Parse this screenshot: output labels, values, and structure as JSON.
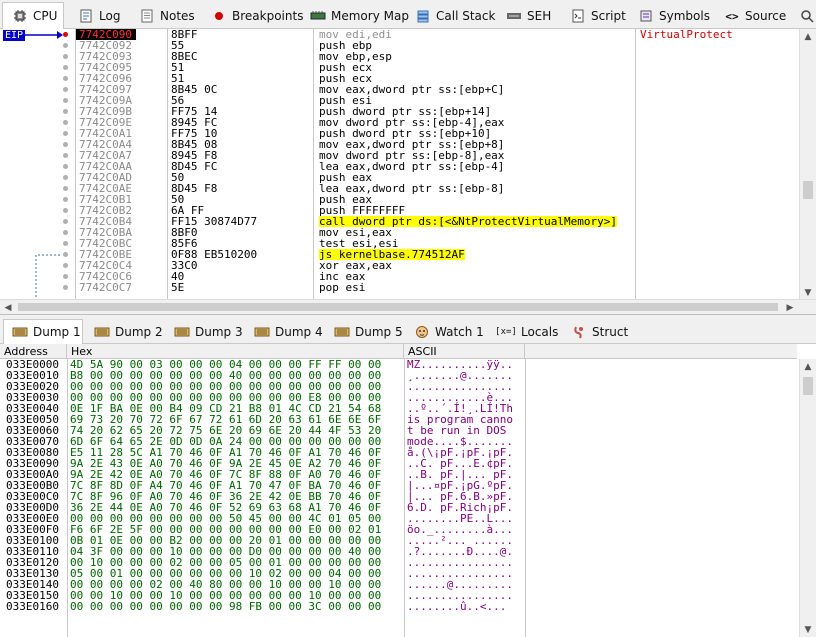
{
  "top_tabs": [
    {
      "label": "CPU",
      "icon": "cpu-icon"
    },
    {
      "label": "Log",
      "icon": "log-icon"
    },
    {
      "label": "Notes",
      "icon": "notes-icon"
    },
    {
      "label": "Breakpoints",
      "icon": "breakpoint-dot-icon"
    },
    {
      "label": "Memory Map",
      "icon": "memory-map-icon"
    },
    {
      "label": "Call Stack",
      "icon": "call-stack-icon"
    },
    {
      "label": "SEH",
      "icon": "seh-icon"
    },
    {
      "label": "Script",
      "icon": "script-icon"
    },
    {
      "label": "Symbols",
      "icon": "symbols-icon"
    },
    {
      "label": "Source",
      "icon": "source-icon"
    }
  ],
  "cpu": {
    "eip_label": "EIP",
    "rows": [
      {
        "addr": "7742C090",
        "bytes": "8BFF",
        "instr": "mov edi,edi",
        "comment": "VirtualProtect",
        "current": true
      },
      {
        "addr": "7742C092",
        "bytes": "55",
        "instr": "push ebp",
        "comment": ""
      },
      {
        "addr": "7742C093",
        "bytes": "8BEC",
        "instr": "mov ebp,esp",
        "comment": ""
      },
      {
        "addr": "7742C095",
        "bytes": "51",
        "instr": "push ecx",
        "comment": ""
      },
      {
        "addr": "7742C096",
        "bytes": "51",
        "instr": "push ecx",
        "comment": ""
      },
      {
        "addr": "7742C097",
        "bytes": "8B45 0C",
        "instr": "mov eax,dword ptr ss:[ebp+C]",
        "comment": ""
      },
      {
        "addr": "7742C09A",
        "bytes": "56",
        "instr": "push esi",
        "comment": ""
      },
      {
        "addr": "7742C09B",
        "bytes": "FF75 14",
        "instr": "push dword ptr ss:[ebp+14]",
        "comment": ""
      },
      {
        "addr": "7742C09E",
        "bytes": "8945 FC",
        "instr": "mov dword ptr ss:[ebp-4],eax",
        "comment": ""
      },
      {
        "addr": "7742C0A1",
        "bytes": "FF75 10",
        "instr": "push dword ptr ss:[ebp+10]",
        "comment": ""
      },
      {
        "addr": "7742C0A4",
        "bytes": "8B45 08",
        "instr": "mov eax,dword ptr ss:[ebp+8]",
        "comment": ""
      },
      {
        "addr": "7742C0A7",
        "bytes": "8945 F8",
        "instr": "mov dword ptr ss:[ebp-8],eax",
        "comment": ""
      },
      {
        "addr": "7742C0AA",
        "bytes": "8D45 FC",
        "instr": "lea eax,dword ptr ss:[ebp-4]",
        "comment": ""
      },
      {
        "addr": "7742C0AD",
        "bytes": "50",
        "instr": "push eax",
        "comment": ""
      },
      {
        "addr": "7742C0AE",
        "bytes": "8D45 F8",
        "instr": "lea eax,dword ptr ss:[ebp-8]",
        "comment": ""
      },
      {
        "addr": "7742C0B1",
        "bytes": "50",
        "instr": "push eax",
        "comment": ""
      },
      {
        "addr": "7742C0B2",
        "bytes": "6A FF",
        "instr": "push FFFFFFFF",
        "comment": ""
      },
      {
        "addr": "7742C0B4",
        "bytes": "FF15 30874D77",
        "instr": "call dword ptr ds:[<&NtProtectVirtualMemory>]",
        "comment": ""
      },
      {
        "addr": "7742C0BA",
        "bytes": "8BF0",
        "instr": "mov esi,eax",
        "comment": ""
      },
      {
        "addr": "7742C0BC",
        "bytes": "85F6",
        "instr": "test esi,esi",
        "comment": ""
      },
      {
        "addr": "7742C0BE",
        "bytes": "0F88 EB510200",
        "instr": "js kernelbase.774512AF",
        "comment": ""
      },
      {
        "addr": "7742C0C4",
        "bytes": "33C0",
        "instr": "xor eax,eax",
        "comment": ""
      },
      {
        "addr": "7742C0C6",
        "bytes": "40",
        "instr": "inc eax",
        "comment": ""
      },
      {
        "addr": "7742C0C7",
        "bytes": "5E",
        "instr": "pop esi",
        "comment": ""
      }
    ]
  },
  "dump_tabs": [
    {
      "label": "Dump 1",
      "icon": "dump-icon"
    },
    {
      "label": "Dump 2",
      "icon": "dump-icon"
    },
    {
      "label": "Dump 3",
      "icon": "dump-icon"
    },
    {
      "label": "Dump 4",
      "icon": "dump-icon"
    },
    {
      "label": "Dump 5",
      "icon": "dump-icon"
    },
    {
      "label": "Watch 1",
      "icon": "watch-icon"
    },
    {
      "label": "Locals",
      "icon": "locals-icon"
    },
    {
      "label": "Struct",
      "icon": "struct-icon"
    }
  ],
  "dump": {
    "headers": {
      "address": "Address",
      "hex": "Hex",
      "ascii": "ASCII"
    },
    "rows": [
      {
        "addr": "033E0000",
        "hex": "4D 5A 90 00 03 00 00 00 04 00 00 00 FF FF 00 00",
        "ascii": "MZ..........ÿÿ.."
      },
      {
        "addr": "033E0010",
        "hex": "B8 00 00 00 00 00 00 00 40 00 00 00 00 00 00 00",
        "ascii": "¸.......@......."
      },
      {
        "addr": "033E0020",
        "hex": "00 00 00 00 00 00 00 00 00 00 00 00 00 00 00 00",
        "ascii": "................"
      },
      {
        "addr": "033E0030",
        "hex": "00 00 00 00 00 00 00 00 00 00 00 00 E8 00 00 00",
        "ascii": "............è..."
      },
      {
        "addr": "033E0040",
        "hex": "0E 1F BA 0E 00 B4 09 CD 21 B8 01 4C CD 21 54 68",
        "ascii": "..º..´.Í!¸.LÍ!Th"
      },
      {
        "addr": "033E0050",
        "hex": "69 73 20 70 72 6F 67 72 61 6D 20 63 61 6E 6E 6F",
        "ascii": "is program canno"
      },
      {
        "addr": "033E0060",
        "hex": "74 20 62 65 20 72 75 6E 20 69 6E 20 44 4F 53 20",
        "ascii": "t be run in DOS "
      },
      {
        "addr": "033E0070",
        "hex": "6D 6F 64 65 2E 0D 0D 0A 24 00 00 00 00 00 00 00",
        "ascii": "mode....$......."
      },
      {
        "addr": "033E0080",
        "hex": "E5 11 28 5C A1 70 46 0F A1 70 46 0F A1 70 46 0F",
        "ascii": "å.(\\¡pF.¡pF.¡pF."
      },
      {
        "addr": "033E0090",
        "hex": "9A 2E 43 0E A0 70 46 0F 9A 2E 45 0E A2 70 46 0F",
        "ascii": "..C. pF...E.¢pF."
      },
      {
        "addr": "033E00A0",
        "hex": "9A 2E 42 0E A0 70 46 0F 7C 8F 88 0F A0 70 46 0F",
        "ascii": "..B. pF.|... pF."
      },
      {
        "addr": "033E00B0",
        "hex": "7C 8F 8D 0F A4 70 46 0F A1 70 47 0F BA 70 46 0F",
        "ascii": "|...¤pF.¡pG.ºpF."
      },
      {
        "addr": "033E00C0",
        "hex": "7C 8F 96 0F A0 70 46 0F 36 2E 42 0E BB 70 46 0F",
        "ascii": "|... pF.6.B.»pF."
      },
      {
        "addr": "033E00D0",
        "hex": "36 2E 44 0E A0 70 46 0F 52 69 63 68 A1 70 46 0F",
        "ascii": "6.D. pF.Rich¡pF."
      },
      {
        "addr": "033E00E0",
        "hex": "00 00 00 00 00 00 00 00 50 45 00 00 4C 01 05 00",
        "ascii": "........PE..L..."
      },
      {
        "addr": "033E00F0",
        "hex": "F6 6F 2E 5F 00 00 00 00 00 00 00 00 E0 00 02 01",
        "ascii": "öo._........à..."
      },
      {
        "addr": "033E0100",
        "hex": "0B 01 0E 00 00 B2 00 00 00 20 01 00 00 00 00 00",
        "ascii": ".....²... ......"
      },
      {
        "addr": "033E0110",
        "hex": "04 3F 00 00 00 10 00 00 00 D0 00 00 00 00 40 00",
        "ascii": ".?.......Ð....@."
      },
      {
        "addr": "033E0120",
        "hex": "00 10 00 00 00 02 00 00 05 00 01 00 00 00 00 00",
        "ascii": "................"
      },
      {
        "addr": "033E0130",
        "hex": "05 00 01 00 00 00 00 00 00 10 02 00 00 04 00 00",
        "ascii": "................"
      },
      {
        "addr": "033E0140",
        "hex": "00 00 00 00 02 00 40 80 00 00 10 00 00 10 00 00",
        "ascii": "......@........."
      },
      {
        "addr": "033E0150",
        "hex": "00 00 10 00 00 10 00 00 00 00 00 00 10 00 00 00",
        "ascii": "................"
      },
      {
        "addr": "033E0160",
        "hex": "00 00 00 00 00 00 00 00 98 FB 00 00 3C 00 00 00",
        "ascii": "........û..<..."
      }
    ]
  }
}
